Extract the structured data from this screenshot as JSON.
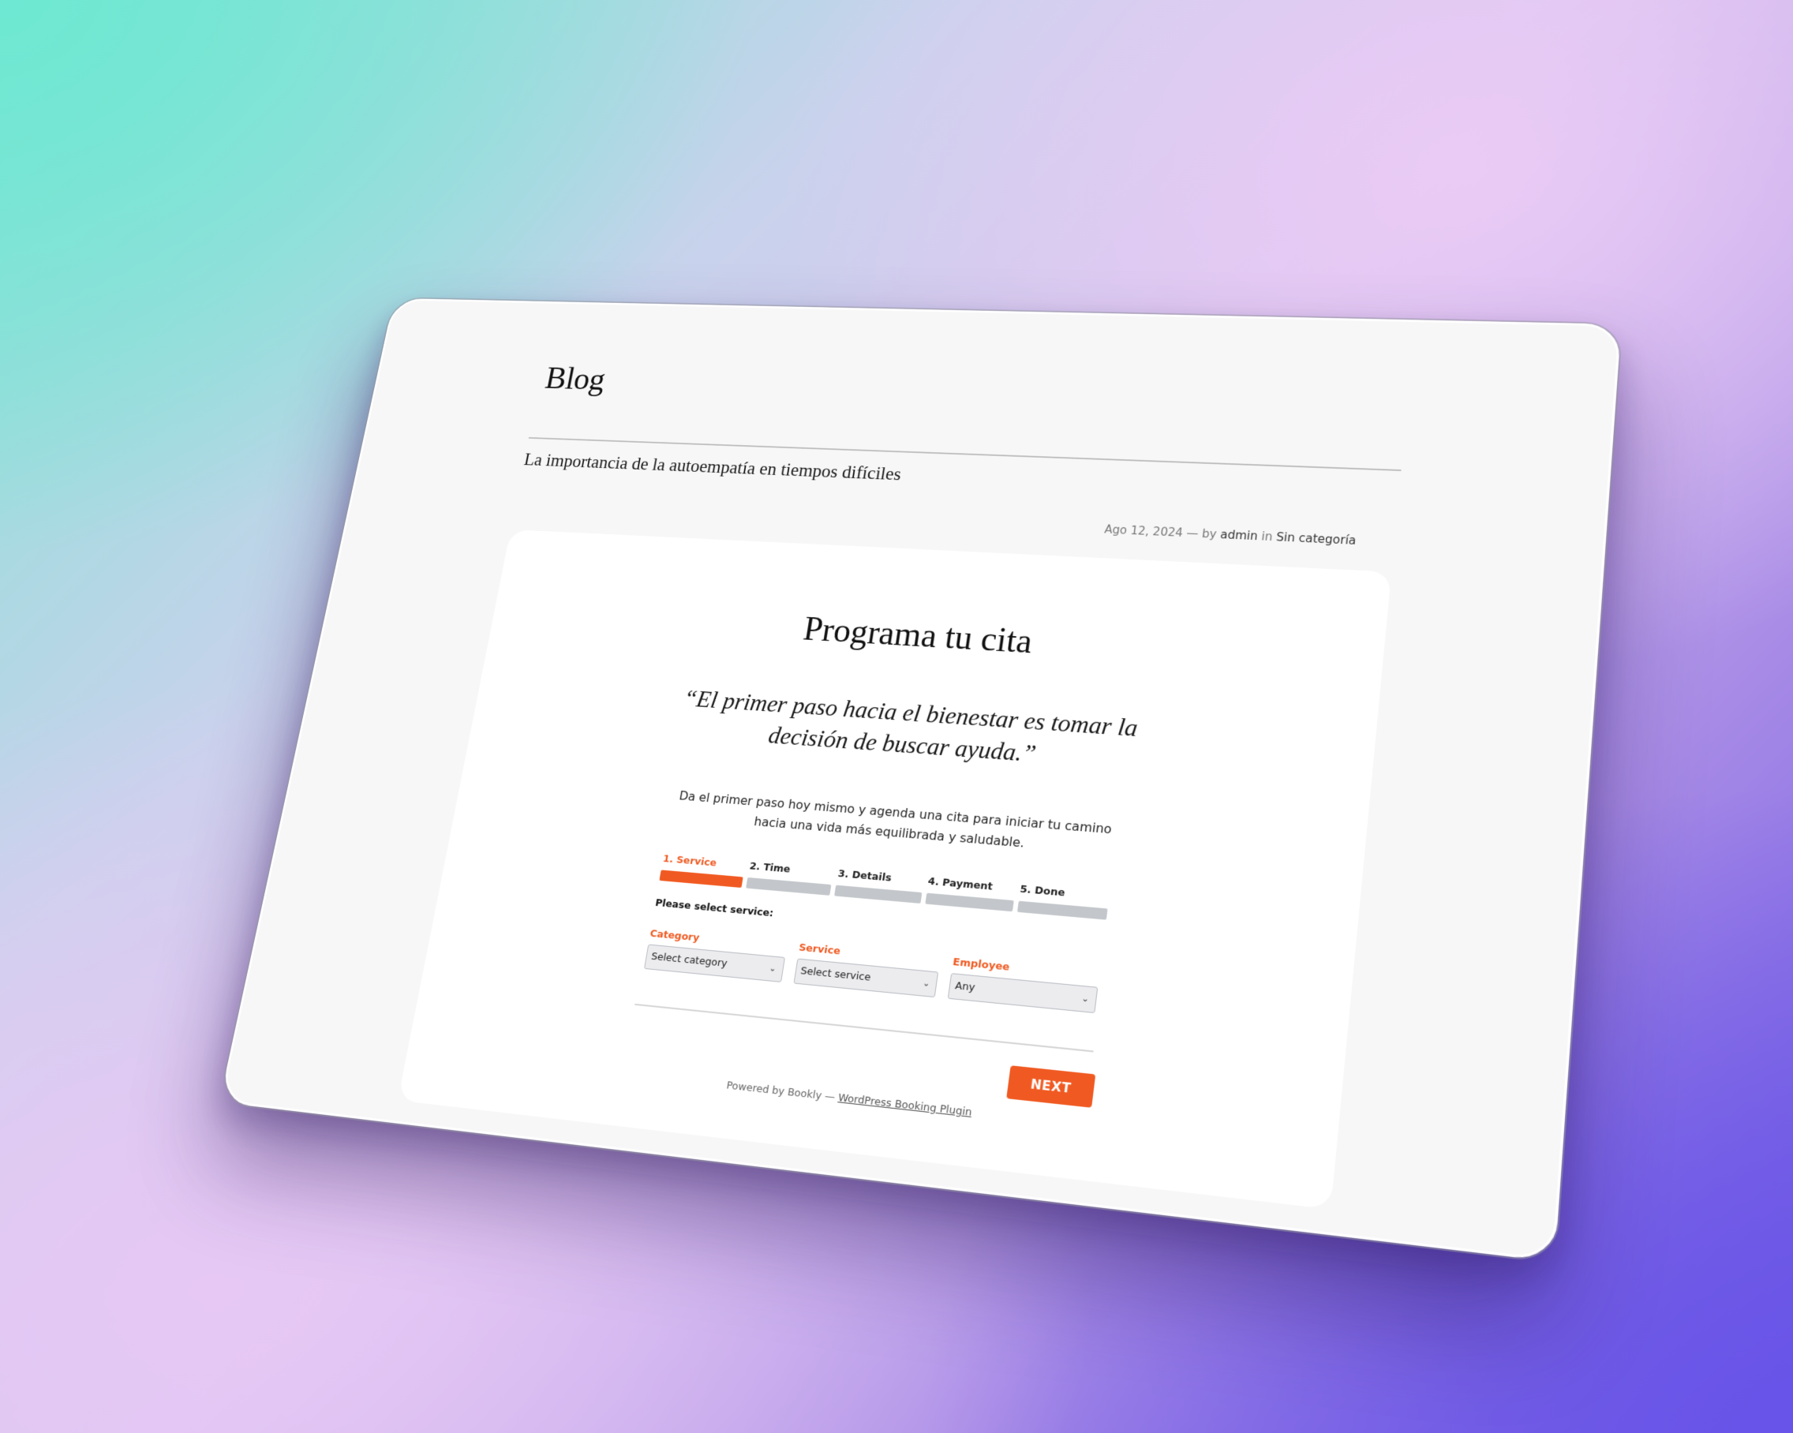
{
  "header": {
    "blog_title": "Blog"
  },
  "post": {
    "title": "La importancia de la autoempatía en tiempos difíciles",
    "date": "Ago 12, 2024",
    "separator": "— by",
    "author": "admin",
    "in_word": "in",
    "category": "Sin categoría"
  },
  "booking": {
    "heading": "Programa tu cita",
    "quote": "“El primer paso hacia el bienestar es tomar la decisión de buscar ayuda.”",
    "intro": "Da el primer paso hoy mismo y agenda una cita para iniciar tu camino hacia una vida más equilibrada y saludable.",
    "steps": [
      {
        "label": "1. Service",
        "active": true
      },
      {
        "label": "2. Time",
        "active": false
      },
      {
        "label": "3. Details",
        "active": false
      },
      {
        "label": "4. Payment",
        "active": false
      },
      {
        "label": "5. Done",
        "active": false
      }
    ],
    "prompt": "Please select service:",
    "fields": {
      "category": {
        "label": "Category",
        "value": "Select category"
      },
      "service": {
        "label": "Service",
        "value": "Select service"
      },
      "employee": {
        "label": "Employee",
        "value": "Any"
      }
    },
    "next_label": "NEXT",
    "powered_prefix": "Powered by Bookly —",
    "powered_link": "WordPress Booking Plugin"
  },
  "colors": {
    "accent": "#f05a22",
    "step_inactive": "#c3c7cb"
  },
  "icons": {
    "dropdown": "chevron-down-icon"
  }
}
